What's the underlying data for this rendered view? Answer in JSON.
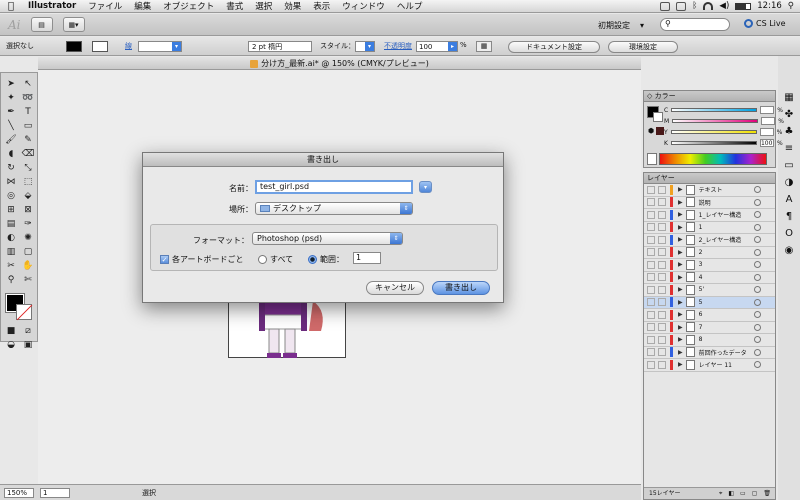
{
  "menubar": {
    "app": "Illustrator",
    "items": [
      "ファイル",
      "編集",
      "オブジェクト",
      "書式",
      "選択",
      "効果",
      "表示",
      "ウィンドウ",
      "ヘルプ"
    ],
    "clock": "12:16"
  },
  "appbar": {
    "logo": "Ai",
    "workspace": "初期設定",
    "cs_live": "CS Live"
  },
  "controlbar": {
    "selection": "選択なし",
    "stroke_label": "線",
    "stroke_style": "2 pt 楕円",
    "style_label": "スタイル：",
    "opacity_label": "不透明度",
    "opacity_value": "100",
    "opacity_unit": "%",
    "doc_settings_button": "ドキュメント設定",
    "prefs_button": "環境設定"
  },
  "document": {
    "title": "分け方_最新.ai* @ 150% (CMYK/プレビュー)"
  },
  "color_panel": {
    "title": "カラー",
    "channels": [
      {
        "label": "C",
        "value": "",
        "color": "#00a0e0"
      },
      {
        "label": "M",
        "value": "",
        "color": "#e0007a"
      },
      {
        "label": "Y",
        "value": "",
        "color": "#f0e000"
      },
      {
        "label": "K",
        "value": "100",
        "color": "#000000"
      }
    ],
    "percent": "%"
  },
  "layers_panel": {
    "title": "レイヤー",
    "layers": [
      {
        "name": "テキスト",
        "color": "#f0a020"
      },
      {
        "name": "説明",
        "color": "#e03030"
      },
      {
        "name": "1_レイヤー構造",
        "color": "#3060e0"
      },
      {
        "name": "1",
        "color": "#e03030"
      },
      {
        "name": "2_レイヤー構造",
        "color": "#3060e0"
      },
      {
        "name": "2",
        "color": "#e03030"
      },
      {
        "name": "3",
        "color": "#e03030"
      },
      {
        "name": "4",
        "color": "#e03030"
      },
      {
        "name": "5'",
        "color": "#e03030"
      },
      {
        "name": "5",
        "color": "#3060e0",
        "selected": true
      },
      {
        "name": "6",
        "color": "#e03030"
      },
      {
        "name": "7",
        "color": "#e03030"
      },
      {
        "name": "8",
        "color": "#e03030"
      },
      {
        "name": "前回作ったデータ",
        "color": "#3060e0"
      },
      {
        "name": "レイヤー 11",
        "color": "#e03030"
      }
    ],
    "footer": "15レイヤー"
  },
  "statusbar": {
    "zoom": "150%",
    "page": "1",
    "tool": "選択"
  },
  "export_dialog": {
    "title": "書き出し",
    "name_label": "名前：",
    "name_value": "test_girl.psd",
    "location_label": "場所：",
    "location_value": "デスクトップ",
    "format_label": "フォーマット：",
    "format_value": "Photoshop (psd)",
    "per_artboard_label": "各アートボードごと",
    "per_artboard_checked": true,
    "all_label": "すべて",
    "range_label": "範囲：",
    "range_value": "1",
    "cancel_button": "キャンセル",
    "export_button": "書き出し"
  }
}
